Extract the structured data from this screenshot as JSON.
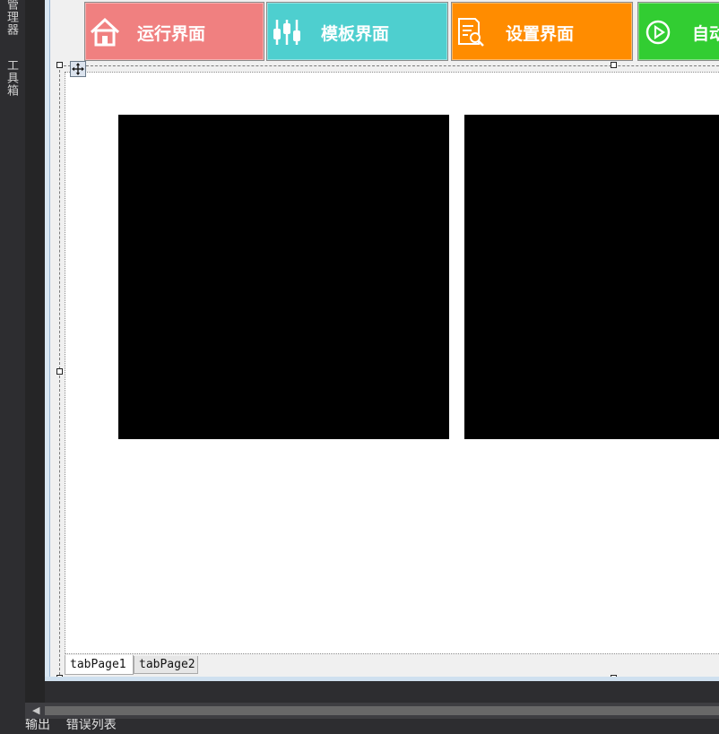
{
  "dock": {
    "tabs": [
      {
        "label": "资源管理器"
      },
      {
        "label": "工具箱"
      }
    ]
  },
  "toolbar": {
    "buttons": [
      {
        "label": "运行界面",
        "icon": "home-icon",
        "color": "#f08080"
      },
      {
        "label": "模板界面",
        "icon": "sliders-icon",
        "color": "#4ecfcf"
      },
      {
        "label": "设置界面",
        "icon": "document-search-icon",
        "color": "#ff8c00"
      },
      {
        "label": "自动",
        "icon": "play-circle-icon",
        "color": "#32cd32"
      }
    ]
  },
  "tabs": [
    {
      "label": "tabPage1",
      "selected": true
    },
    {
      "label": "tabPage2",
      "selected": false
    }
  ],
  "bottom_panel": {
    "tabs_text": "输出    错误列表"
  }
}
